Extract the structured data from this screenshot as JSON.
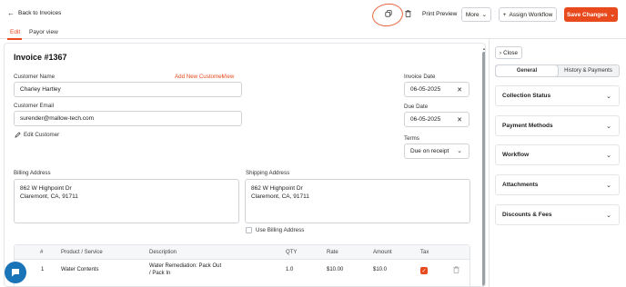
{
  "header": {
    "back_label": "Back to Invoices",
    "print_label": "Print Preview",
    "more_label": "More",
    "assign_label": "Assign Workflow",
    "save_label": "Save Changes"
  },
  "tabs": [
    {
      "label": "Edit",
      "active": true
    },
    {
      "label": "Payor view",
      "active": false
    }
  ],
  "invoice": {
    "title": "Invoice #1367",
    "customer_name_label": "Customer Name",
    "customer_name_value": "Charley Hartley",
    "add_new_customer": "Add New Customer",
    "view_label": "View",
    "customer_email_label": "Customer Email",
    "customer_email_value": "surender@mallow-tech.com",
    "edit_customer": "Edit Customer",
    "invoice_date_label": "Invoice Date",
    "invoice_date_value": "06-05-2025",
    "due_date_label": "Due Date",
    "due_date_value": "06-05-2025",
    "terms_label": "Terms",
    "terms_value": "Due on receipt",
    "billing_label": "Billing Address",
    "billing_line1": "862 W Highpoint Dr",
    "billing_line2": "Claremont, CA, 91711",
    "shipping_label": "Shipping Address",
    "shipping_line1": "862 W Highpoint Dr",
    "shipping_line2": "Claremont, CA, 91711",
    "use_billing_label": "Use Billing Address"
  },
  "table": {
    "headers": [
      "#",
      "Product / Service",
      "Description",
      "QTY",
      "Rate",
      "Amount",
      "Tax"
    ],
    "rows": [
      {
        "num": "1",
        "product": "Water Contents",
        "desc_line1": "Water Remediation: Pack Out",
        "desc_line2": "/ Pack In",
        "qty": "1.0",
        "rate": "$10.00",
        "amount": "$10.0",
        "tax": true
      }
    ]
  },
  "sidebar": {
    "close_label": "Close",
    "seg_general": "General",
    "seg_history": "History & Payments",
    "sections": [
      "Collection Status",
      "Payment Methods",
      "Workflow",
      "Attachments",
      "Discounts & Fees"
    ]
  },
  "colors": {
    "accent": "#e8491d",
    "chat": "#1a74b8"
  }
}
